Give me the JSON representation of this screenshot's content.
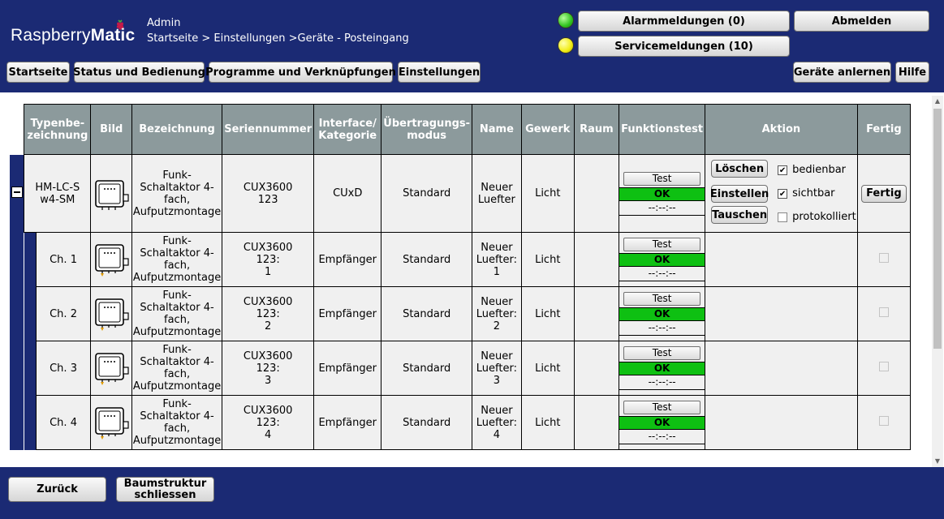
{
  "header": {
    "logo_light": "Raspberry",
    "logo_bold": "Matic",
    "user": "Admin",
    "breadcrumb": "Startseite > Einstellungen >Geräte - Posteingang",
    "alarm_label": "Alarmmeldungen (0)",
    "service_label": "Servicemeldungen (10)",
    "logout_label": "Abmelden",
    "alarm_led_color": "#2fc21e",
    "service_led_color": "#f0ec12"
  },
  "nav": {
    "home": "Startseite",
    "status": "Status und Bedienung",
    "programs": "Programme und Verknüpfungen",
    "settings": "Einstellungen",
    "learn": "Geräte anlernen",
    "help": "Hilfe"
  },
  "table": {
    "headers": {
      "type": "Typenbe-\nzeichnung",
      "image": "Bild",
      "name": "Bezeichnung",
      "serial": "Seriennummer",
      "interface": "Interface/\nKategorie",
      "mode": "Übertragungs-\nmodus",
      "devname": "Name",
      "trade": "Gewerk",
      "room": "Raum",
      "functest": "Funktionstest",
      "action": "Aktion",
      "done": "Fertig"
    },
    "device": {
      "type": "HM-LC-S\nw4-SM",
      "image_icon": "actuator-box-icon",
      "description": "Funk-\nSchaltaktor 4-\nfach,\nAufputzmontage",
      "serial": "CUX3600\n123",
      "interface": "CUxD",
      "mode": "Standard",
      "name": "Neuer\nLuefter",
      "trade": "Licht",
      "room": "",
      "test_label": "Test",
      "status": "OK",
      "timestamp": "--:--:--",
      "delete_label": "Löschen",
      "configure_label": "Einstellen",
      "swap_label": "Tauschen",
      "opt_operable": "bedienbar",
      "opt_visible": "sichtbar",
      "opt_logged": "protokolliert",
      "done_label": "Fertig"
    },
    "channels": [
      {
        "label": "Ch. 1",
        "description": "Funk-\nSchaltaktor 4-\nfach,\nAufputzmontage",
        "serial": "CUX3600\n123:\n1",
        "interface": "Empfänger",
        "mode": "Standard",
        "name": "Neuer\nLuefter:\n1",
        "trade": "Licht",
        "room": "",
        "test_label": "Test",
        "status": "OK",
        "timestamp": "--:--:--"
      },
      {
        "label": "Ch. 2",
        "description": "Funk-\nSchaltaktor 4-\nfach,\nAufputzmontage",
        "serial": "CUX3600\n123:\n2",
        "interface": "Empfänger",
        "mode": "Standard",
        "name": "Neuer\nLuefter:\n2",
        "trade": "Licht",
        "room": "",
        "test_label": "Test",
        "status": "OK",
        "timestamp": "--:--:--"
      },
      {
        "label": "Ch. 3",
        "description": "Funk-\nSchaltaktor 4-\nfach,\nAufputzmontage",
        "serial": "CUX3600\n123:\n3",
        "interface": "Empfänger",
        "mode": "Standard",
        "name": "Neuer\nLuefter:\n3",
        "trade": "Licht",
        "room": "",
        "test_label": "Test",
        "status": "OK",
        "timestamp": "--:--:--"
      },
      {
        "label": "Ch. 4",
        "description": "Funk-\nSchaltaktor 4-\nfach,\nAufputzmontage",
        "serial": "CUX3600\n123:\n4",
        "interface": "Empfänger",
        "mode": "Standard",
        "name": "Neuer\nLuefter:\n4",
        "trade": "Licht",
        "room": "",
        "test_label": "Test",
        "status": "OK",
        "timestamp": "--:--:--"
      }
    ]
  },
  "footer": {
    "back": "Zurück",
    "collapse": "Baumstruktur\nschliessen"
  },
  "colors": {
    "brand_navy": "#1b2a74",
    "header_gray": "#8c9a9c",
    "ok_green": "#0ec012"
  }
}
